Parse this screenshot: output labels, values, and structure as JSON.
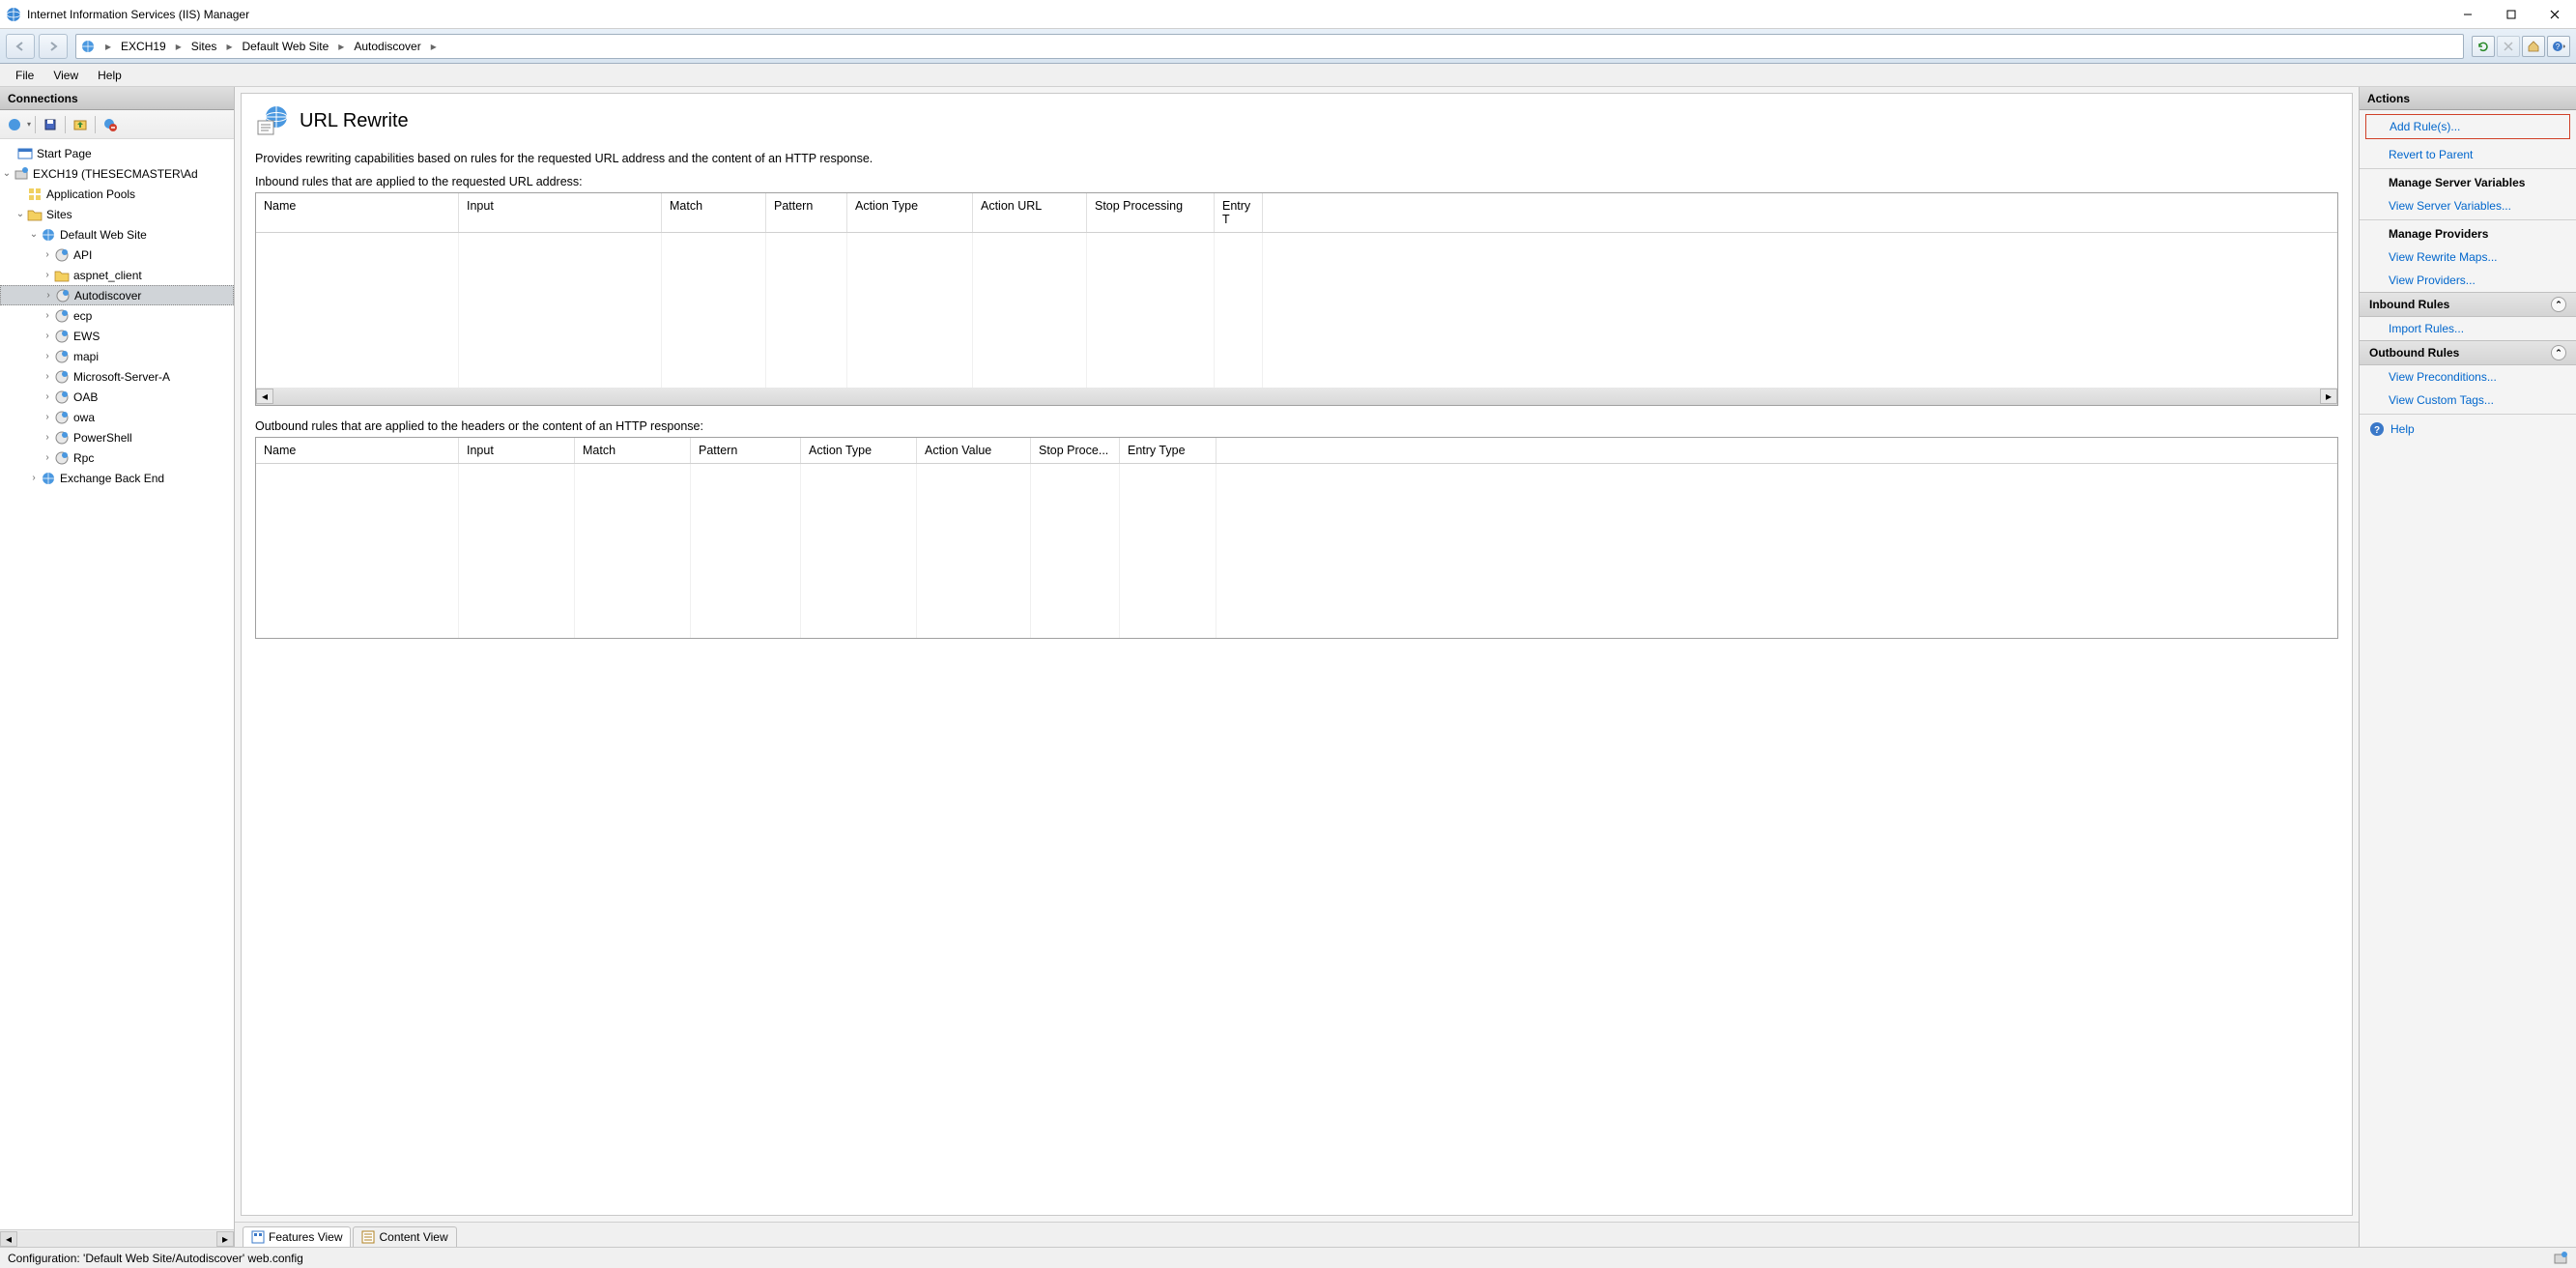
{
  "window": {
    "title": "Internet Information Services (IIS) Manager"
  },
  "breadcrumb": {
    "items": [
      "EXCH19",
      "Sites",
      "Default Web Site",
      "Autodiscover"
    ]
  },
  "menu": {
    "file": "File",
    "view": "View",
    "help": "Help"
  },
  "connections": {
    "title": "Connections",
    "start_page": "Start Page",
    "server": "EXCH19 (THESECMASTER\\Ad",
    "app_pools": "Application Pools",
    "sites": "Sites",
    "default_site": "Default Web Site",
    "children": [
      "API",
      "aspnet_client",
      "Autodiscover",
      "ecp",
      "EWS",
      "mapi",
      "Microsoft-Server-A",
      "OAB",
      "owa",
      "PowerShell",
      "Rpc"
    ],
    "exchange_back_end": "Exchange Back End"
  },
  "feature": {
    "title": "URL Rewrite",
    "description": "Provides rewriting capabilities based on rules for the requested URL address and the content of an HTTP response.",
    "inbound_label": "Inbound rules that are applied to the requested URL address:",
    "outbound_label": "Outbound rules that are applied to the headers or the content of an HTTP response:",
    "inbound_columns": [
      "Name",
      "Input",
      "Match",
      "Pattern",
      "Action Type",
      "Action URL",
      "Stop Processing",
      "Entry T"
    ],
    "outbound_columns": [
      "Name",
      "Input",
      "Match",
      "Pattern",
      "Action Type",
      "Action Value",
      "Stop Proce...",
      "Entry Type"
    ]
  },
  "view_tabs": {
    "features": "Features View",
    "content": "Content View"
  },
  "actions": {
    "title": "Actions",
    "add_rules": "Add Rule(s)...",
    "revert": "Revert to Parent",
    "manage_server_vars": "Manage Server Variables",
    "view_server_vars": "View Server Variables...",
    "manage_providers": "Manage Providers",
    "view_rewrite_maps": "View Rewrite Maps...",
    "view_providers": "View Providers...",
    "inbound_rules": "Inbound Rules",
    "import_rules": "Import Rules...",
    "outbound_rules": "Outbound Rules",
    "view_preconditions": "View Preconditions...",
    "view_custom_tags": "View Custom Tags...",
    "help": "Help"
  },
  "status": {
    "config": "Configuration: 'Default Web Site/Autodiscover' web.config"
  }
}
